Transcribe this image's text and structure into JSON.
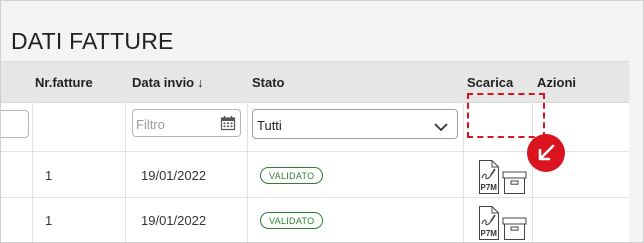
{
  "page": {
    "title": "DATI FATTURE"
  },
  "table": {
    "headers": {
      "nr_fatture": "Nr.fatture",
      "data_invio": "Data invio",
      "stato": "Stato",
      "scarica": "Scarica",
      "azioni": "Azioni"
    },
    "sort_indicator": "↓",
    "filters": {
      "date_placeholder": "Filtro",
      "stato_selected": "Tutti"
    },
    "rows": [
      {
        "nr_fatture": "1",
        "data_invio": "19/01/2022",
        "stato": "VALIDATO"
      },
      {
        "nr_fatture": "1",
        "data_invio": "19/01/2022",
        "stato": "VALIDATO"
      }
    ],
    "download_labels": {
      "p7m": "P7M"
    }
  },
  "colors": {
    "header_bg": "#e6e6e6",
    "badge_green": "#2e7d32",
    "highlight_red": "#d9141e"
  },
  "icons": {
    "date_filter": "calendar-icon",
    "select_chevron": "chevron-down-icon",
    "p7m_download": "p7m-file-icon",
    "archive_download": "archive-box-icon",
    "annotation": "arrow-down-left-icon"
  }
}
